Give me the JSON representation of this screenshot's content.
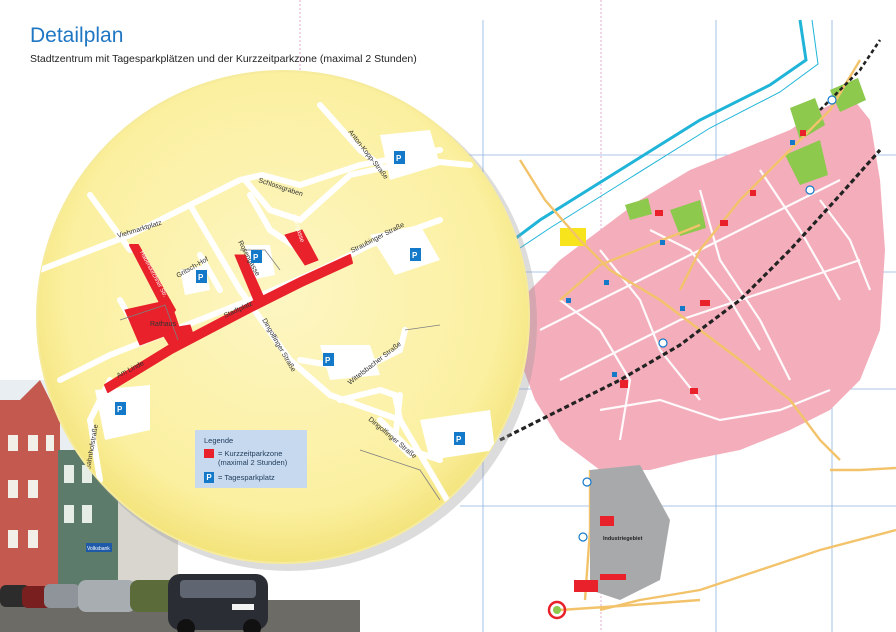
{
  "header": {
    "title": "Detailplan",
    "subtitle": "Stadtzentrum mit Tagesparkplätzen und der Kurzzeitparkzone (maximal 2 Stunden)"
  },
  "colors": {
    "accent_title": "#1f77c4",
    "circle_fill": "#fbf1a6",
    "town_area": "#f4adbb",
    "short_term_zone": "#e8212a",
    "parking_sign": "#1479c9",
    "main_road": "#f3c36b",
    "river": "#1fb4d8",
    "grid": "#2f73c9",
    "green_area": "#8cc94d",
    "industry": "#a8a9ab"
  },
  "legend": {
    "title": "Legende",
    "short_term_label": "= Kurzzeitparkzone",
    "short_term_sub": "(maximal 2 Stunden)",
    "parking_label": "= Tagesparkplatz"
  },
  "parking_symbol": "P",
  "detail_streets": {
    "viehmarktplatz": "Viehmarktplatz",
    "schlossgraben": "Schlossgraben",
    "anton_kopp": "Anton-Kopp-Straße",
    "straubinger": "Straubinger Straße",
    "stadtplatz": "Stadtplatz",
    "am_linde": "Am Linde",
    "rathaus": "Rathaus",
    "gritsch_hof": "Gritsch-Hof",
    "rosengasse": "Rosengasse",
    "dingolfinger": "Dingolfinger Straße",
    "wittelsbacher": "Wittelsbacher Straße",
    "dingolfinger_2": "Dingolfinger Straße",
    "haberskirchner": "Haberskirchner Str.",
    "pfarrgasse": "Pfarrgasse",
    "bahnhofstrasse": "Bahnhofstraße"
  },
  "overview_labels": {
    "industriegebiet": "Industriegebiet"
  },
  "photo": {
    "bank_sign": "Volksbank"
  }
}
